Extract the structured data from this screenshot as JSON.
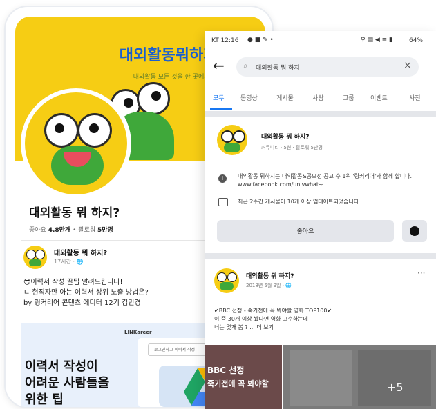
{
  "left_phone": {
    "cover_title": "대외활동뭐하지?",
    "cover_subtitle": "대외활동 모든 것을 한 곳에서 보세요",
    "page_name": "대외활동 뭐 하지?",
    "stats": {
      "likes_label": "좋아요",
      "likes_value": "4.8만개",
      "sep": "•",
      "followers_label": "팔로워",
      "followers_value": "5만명"
    },
    "post": {
      "name": "대외활동 뭐 하지?",
      "meta": "17시간 · 🌐",
      "lines": [
        "😎이력서 작성 꿀팁 알려드립니다!",
        "ㄴ 현직자만 아는 이력서 상위 노출 방법은?",
        "by 링커리어 콘텐츠 에디터 12기 김민경"
      ]
    },
    "ad": {
      "brand": "LINKareer",
      "search_hint": "로그인하고 이력서 작성",
      "headline_lines": [
        "이력서 작성이",
        "어려운 사람들을",
        "위한 팁"
      ]
    }
  },
  "facebook": {
    "status_time": "KT 12:16",
    "status_battery": "64%",
    "search_query": "대외활동 뭐 하지",
    "tabs": [
      "모두",
      "동영상",
      "게시물",
      "사람",
      "그룹",
      "이벤트",
      "사진"
    ],
    "active_tab": "모두",
    "page_result": {
      "name": "대외활동 뭐 하지?",
      "meta": "커뮤니티 · 5천 · 팔로워 5만명",
      "info_text_1": "대외활동 뭐하지는 대외활동&공모전 공고 수 1위 '링커리어'와 함께 합니다. www.facebook.com/univwhat~",
      "info_text_2": "최근 2주간 게시물이 10개 이상 업데이트되었습니다",
      "like_button": "좋아요"
    },
    "post": {
      "name": "대외활동 뭐 하지?",
      "meta": "2018년 5월 9일 · 🌐",
      "lines": [
        "✔BBC 선정 - 죽기전에 꼭 봐야할 영화 TOP100✔",
        "이 중 30개 이상 봤다면 영화 고수하는데",
        "너는 몇개 봄 ? ... 더 보기"
      ],
      "more_icon": "more-icon",
      "thumb_caption_1": "BBC 선정",
      "thumb_caption_2": "죽기전에 꼭 봐야할",
      "thumb_plus": "+5"
    }
  }
}
